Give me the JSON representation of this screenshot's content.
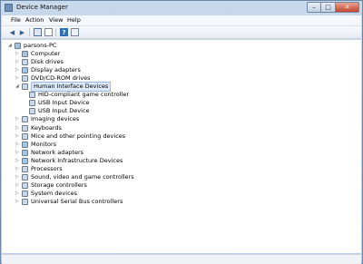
{
  "window": {
    "title": "Device Manager"
  },
  "menu": [
    "File",
    "Action",
    "View",
    "Help"
  ],
  "toolbar": [
    "back-icon",
    "forward-icon",
    "properties-icon",
    "list-icon",
    "help-icon",
    "show-hidden-icon"
  ],
  "tree": [
    {
      "label": "parsons-PC",
      "icon": "computer-icon",
      "expanded": true
    },
    {
      "label": "Computer",
      "icon": "computer-icon"
    },
    {
      "label": "Disk drives",
      "icon": "disk-drive-icon"
    },
    {
      "label": "Display adapters",
      "icon": "monitor-icon"
    },
    {
      "label": "DVD/CD-ROM drives",
      "icon": "dvd-icon"
    },
    {
      "label": "Human Interface Devices",
      "icon": "hid-icon",
      "expanded": true,
      "selected": true
    },
    {
      "label": "HID-compliant game controller",
      "icon": "hid-device-icon"
    },
    {
      "label": "USB Input Device",
      "icon": "hid-device-icon"
    },
    {
      "label": "USB Input Device",
      "icon": "hid-device-icon"
    },
    {
      "label": "Imaging devices",
      "icon": "camera-icon"
    },
    {
      "label": "Keyboards",
      "icon": "keyboard-icon"
    },
    {
      "label": "Mice and other pointing devices",
      "icon": "mouse-icon"
    },
    {
      "label": "Monitors",
      "icon": "monitor-icon"
    },
    {
      "label": "Network adapters",
      "icon": "network-icon"
    },
    {
      "label": "Network Infrastructure Devices",
      "icon": "network-icon"
    },
    {
      "label": "Processors",
      "icon": "processor-icon"
    },
    {
      "label": "Sound, video and game controllers",
      "icon": "sound-icon"
    },
    {
      "label": "Storage controllers",
      "icon": "storage-icon"
    },
    {
      "label": "System devices",
      "icon": "system-icon"
    },
    {
      "label": "Universal Serial Bus controllers",
      "icon": "usb-icon"
    }
  ]
}
